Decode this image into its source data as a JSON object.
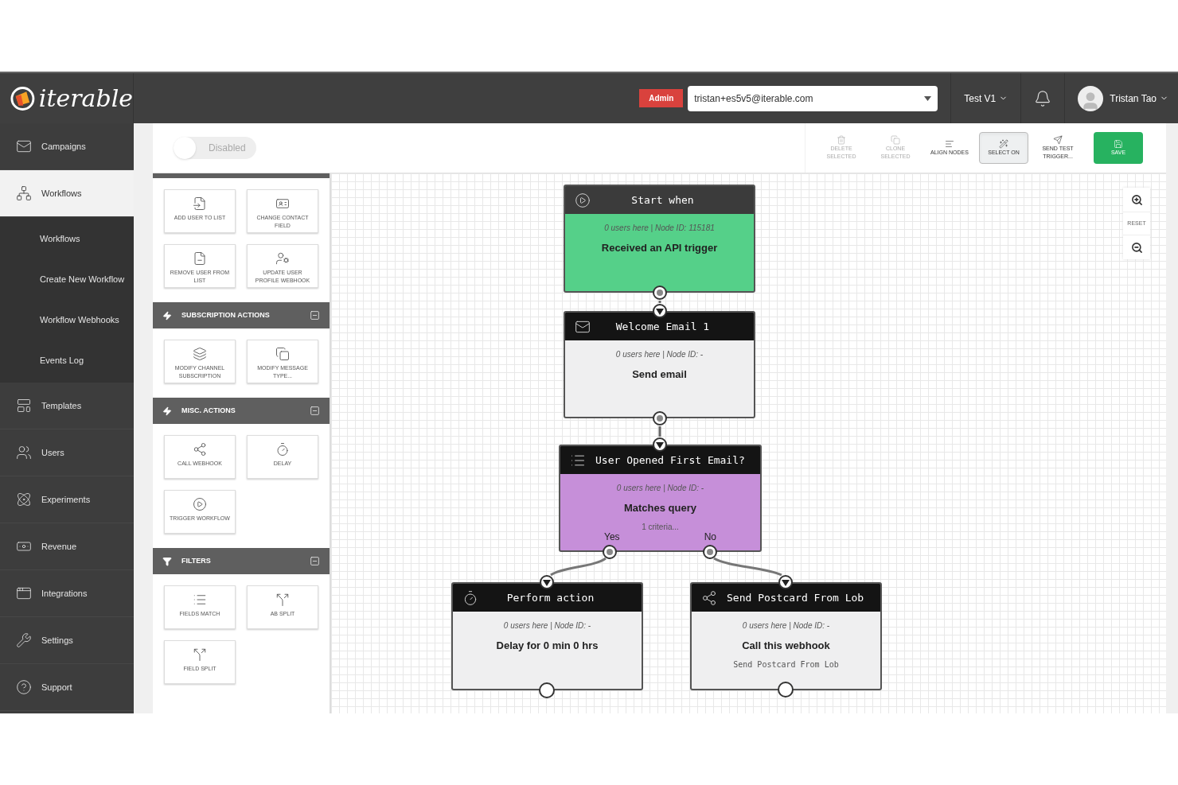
{
  "header": {
    "logo": "iterable",
    "role_badge": "Admin",
    "account": {
      "value": "tristan+es5v5@iterable.com"
    },
    "project": "Test V1",
    "user": "Tristan Tao"
  },
  "sidebar": {
    "items": [
      {
        "label": "Campaigns",
        "selected": false
      },
      {
        "label": "Workflows",
        "selected": true,
        "children": [
          {
            "label": "Workflows"
          },
          {
            "label": "Create New Workflow"
          },
          {
            "label": "Workflow Webhooks"
          },
          {
            "label": "Events Log"
          }
        ]
      },
      {
        "label": "Templates",
        "selected": false
      },
      {
        "label": "Users",
        "selected": false
      },
      {
        "label": "Experiments",
        "selected": false
      },
      {
        "label": "Revenue",
        "selected": false
      },
      {
        "label": "Integrations",
        "selected": false
      },
      {
        "label": "Settings",
        "selected": false
      },
      {
        "label": "Support",
        "selected": false
      }
    ]
  },
  "toolbar": {
    "toggle": {
      "label": "Disabled",
      "on": false
    },
    "buttons": [
      {
        "kind": "delete",
        "label": "DELETE SELECTED",
        "disabled": true,
        "selected": false
      },
      {
        "kind": "clone",
        "label": "CLONE SELECTED",
        "disabled": true,
        "selected": false
      },
      {
        "kind": "align",
        "label": "ALIGN NODES",
        "disabled": false,
        "selected": false
      },
      {
        "kind": "select",
        "label": "SELECT ON",
        "disabled": false,
        "selected": true
      },
      {
        "kind": "test",
        "label": "SEND TEST TRIGGER...",
        "disabled": false,
        "selected": false
      },
      {
        "kind": "save",
        "label": "SAVE",
        "disabled": false,
        "selected": false
      }
    ]
  },
  "palette": {
    "sections": [
      {
        "items": [
          {
            "label": "ADD USER TO LIST"
          },
          {
            "label": "CHANGE CONTACT FIELD"
          },
          {
            "label": "REMOVE USER FROM LIST"
          },
          {
            "label": "UPDATE USER PROFILE WEBHOOK"
          }
        ]
      },
      {
        "kind": "action",
        "title": "SUBSCRIPTION ACTIONS",
        "items": [
          {
            "label": "MODIFY CHANNEL SUBSCRIPTION"
          },
          {
            "label": "MODIFY MESSAGE TYPE..."
          }
        ]
      },
      {
        "kind": "action",
        "title": "MISC. ACTIONS",
        "items": [
          {
            "label": "CALL WEBHOOK"
          },
          {
            "label": "DELAY"
          },
          {
            "label": "TRIGGER WORKFLOW"
          }
        ]
      },
      {
        "kind": "filter",
        "title": "FILTERS",
        "items": [
          {
            "label": "FIELDS MATCH"
          },
          {
            "label": "AB SPLIT"
          },
          {
            "label": "FIELD SPLIT"
          }
        ]
      }
    ]
  },
  "canvas": {
    "nodes": [
      {
        "kind": "trigger",
        "title": "Start when",
        "stats": "0 users here | Node ID: 115181",
        "action": "Received an API trigger"
      },
      {
        "kind": "email",
        "title": "Welcome Email 1",
        "stats": "0 users here | Node ID: -",
        "action": "Send email"
      },
      {
        "kind": "filter",
        "title": "User Opened First Email?",
        "stats": "0 users here | Node ID: -",
        "action": "Matches query",
        "detail": "1 criteria...",
        "branches": [
          "Yes",
          "No"
        ]
      },
      {
        "kind": "delay",
        "title": "Perform action",
        "stats": "0 users here | Node ID: -",
        "action": "Delay for 0 min 0 hrs"
      },
      {
        "kind": "webhook",
        "title": "Send Postcard From Lob",
        "stats": "0 users here | Node ID: -",
        "action": "Call this webhook",
        "detail": "Send Postcard From Lob"
      }
    ],
    "zoom": {
      "reset": "RESET"
    }
  }
}
